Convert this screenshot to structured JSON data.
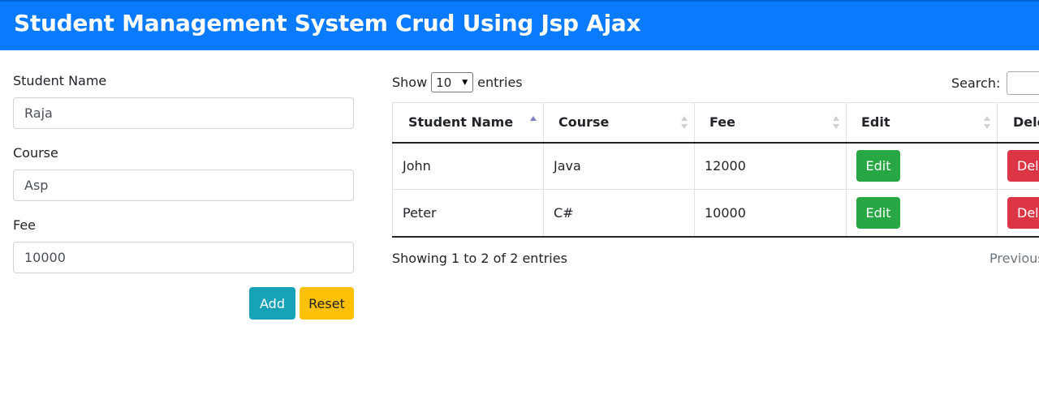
{
  "header": {
    "title": "Student Management System Crud Using Jsp Ajax"
  },
  "form": {
    "name_label": "Student Name",
    "name_value": "Raja",
    "course_label": "Course",
    "course_value": "Asp",
    "fee_label": "Fee",
    "fee_value": "10000",
    "add_label": "Add",
    "reset_label": "Reset"
  },
  "datatable": {
    "show_label": "Show",
    "entries_value": "10",
    "entries_label": "entries",
    "search_label": "Search:",
    "columns": [
      "Student Name",
      "Course",
      "Fee",
      "Edit",
      "Delete"
    ],
    "rows": [
      {
        "name": "John",
        "course": "Java",
        "fee": "12000",
        "edit": "Edit",
        "delete": "Delete"
      },
      {
        "name": "Peter",
        "course": "C#",
        "fee": "10000",
        "edit": "Edit",
        "delete": "Delete"
      }
    ],
    "info": "Showing 1 to 2 of 2 entries",
    "previous_label": "Previous"
  },
  "colors": {
    "header": "#0a7bff",
    "add_button": "#17a2b8",
    "reset_button": "#ffc107",
    "edit_button": "#28a745",
    "delete_button": "#dc3545"
  }
}
